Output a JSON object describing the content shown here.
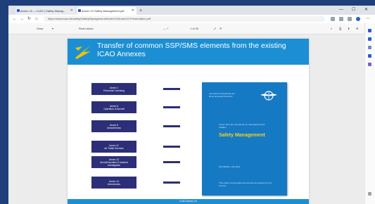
{
  "browser": {
    "tabs": [
      {
        "label": "Annex 19 — ICAO | Safety Manag..."
      },
      {
        "label": "Annex 19 Safety Management.pdf"
      }
    ],
    "new_tab_label": "+",
    "url": "https://www.icao.int/safety/SafetyManagement/Annex19/Annex19-Presentation.pdf"
  },
  "pdf_toolbar": {
    "draw_label": "Draw",
    "read_aloud_label": "Read aloud",
    "zoom": "— +",
    "page_label": "1 of 20"
  },
  "slide": {
    "title": "Transfer of common SSP/SMS elements from the existing ICAO Annexes",
    "annexes": [
      {
        "line1": "Annex 1",
        "line2": "Personnel Licensing"
      },
      {
        "line1": "Annex 6",
        "line2": "Operation of Aircraft"
      },
      {
        "line1": "Annex 8",
        "line2": "Airworthiness"
      },
      {
        "line1": "Annex 11",
        "line2": "Air Traffic Services"
      },
      {
        "line1": "Annex 13",
        "line2": "Aircraft Accident & Incident Investigation"
      },
      {
        "line1": "Annex 14",
        "line2": "Aerodromes"
      }
    ],
    "book": {
      "top_text": "International Standards and Recommended Practices",
      "doc_text": "Annex 19 to the Convention on International Civil Aviation",
      "title": "Safety Management",
      "edition": "First Edition, July 2013",
      "approved": "This edition incorporates all amendments adopted by the Council"
    },
    "footer": "ICAO Annex 19"
  }
}
